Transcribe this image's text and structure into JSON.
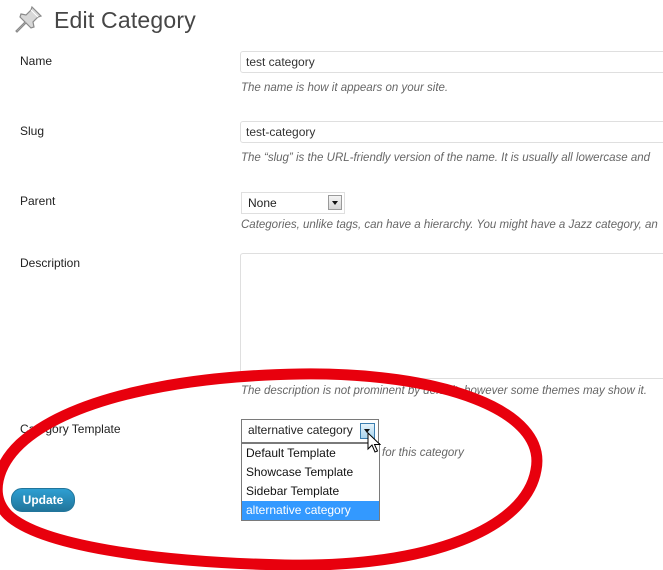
{
  "page": {
    "title": "Edit Category",
    "icon": "pushpin-icon"
  },
  "form": {
    "name": {
      "label": "Name",
      "value": "test category",
      "hint": "The name is how it appears on your site."
    },
    "slug": {
      "label": "Slug",
      "value": "test-category",
      "hint": "The “slug” is the URL-friendly version of the name. It is usually all lowercase and"
    },
    "parent": {
      "label": "Parent",
      "selected": "None",
      "hint": "Categories, unlike tags, can have a hierarchy. You might have a Jazz category, an"
    },
    "description": {
      "label": "Description",
      "value": "",
      "hint": "The description is not prominent by default, however some themes may show it."
    },
    "category_template": {
      "label": "Category Template",
      "selected": "alternative category",
      "hint_visible": "for this category",
      "options": [
        "Default Template",
        "Showcase Template",
        "Sidebar Template",
        "alternative category"
      ],
      "highlighted_option": "alternative category"
    }
  },
  "actions": {
    "update_label": "Update"
  },
  "colors": {
    "primary_button": "#21759b",
    "selection_highlight": "#3399ff",
    "annotation_ellipse": "#e8000d"
  }
}
